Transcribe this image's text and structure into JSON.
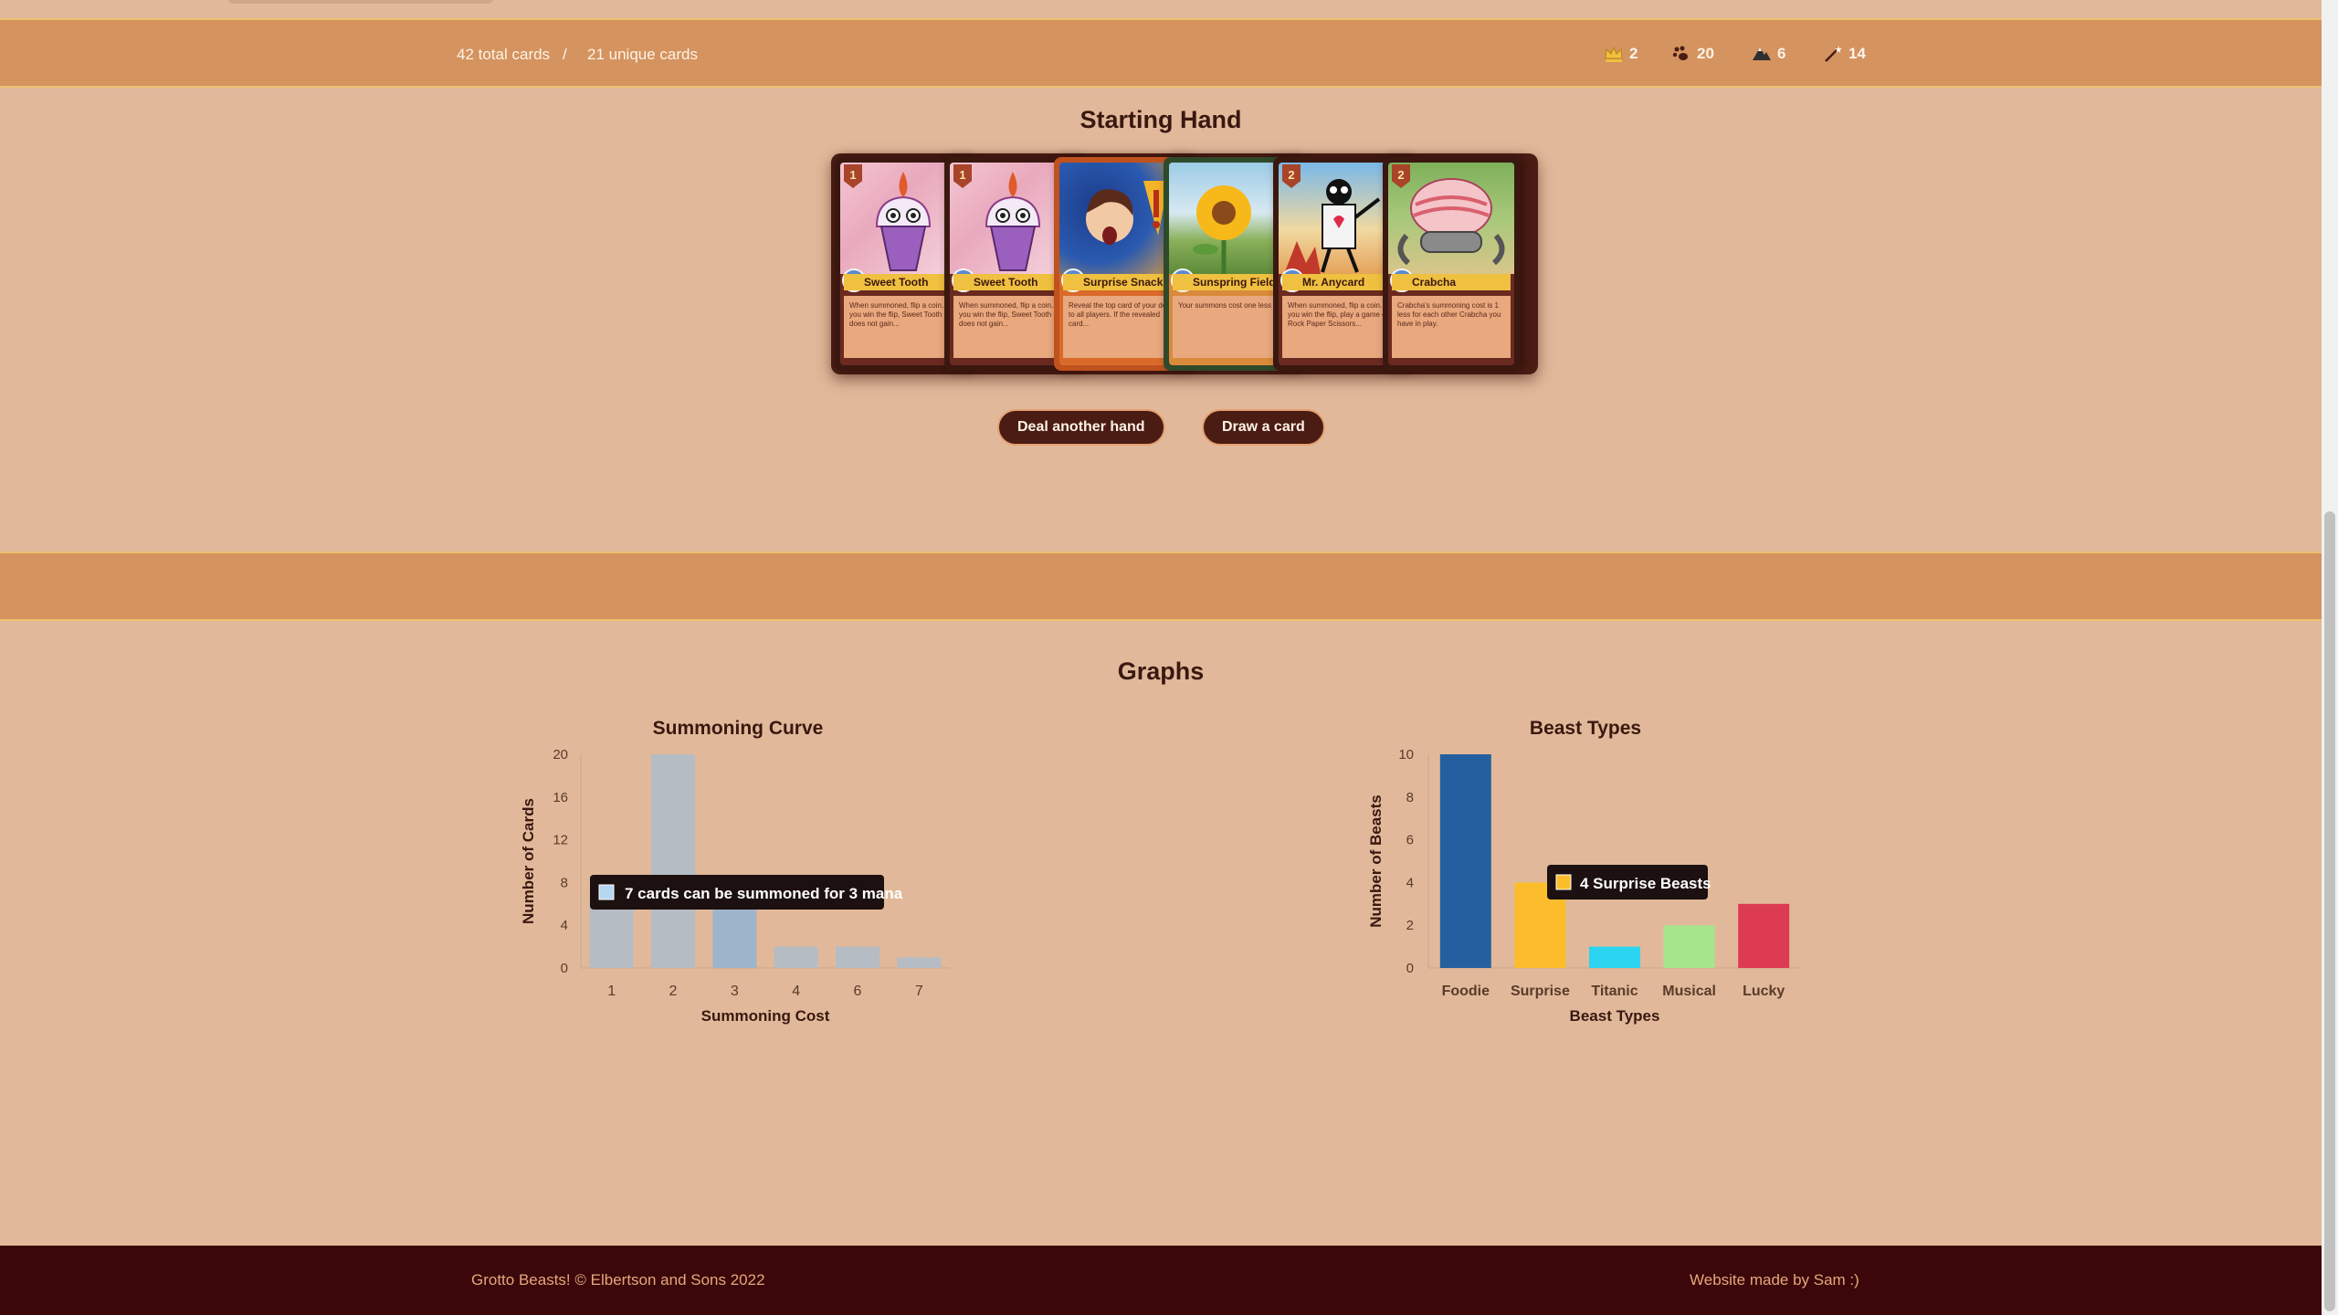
{
  "stats": {
    "total_cards": "42 total cards",
    "separator": "/",
    "unique_cards": "21 unique cards",
    "types": [
      {
        "icon": "crown-icon",
        "count": "2",
        "color": "#f0c040"
      },
      {
        "icon": "paw-icon",
        "count": "20",
        "color": "#3a1810"
      },
      {
        "icon": "mountain-icon",
        "count": "6",
        "color": "#3a1810"
      },
      {
        "icon": "wand-icon",
        "count": "14",
        "color": "#3a1810"
      }
    ]
  },
  "hand": {
    "title": "Starting Hand",
    "cards": [
      {
        "name": "Sweet Tooth",
        "cost": "1",
        "gem": "2",
        "art": "sweet",
        "text": "When summoned, flip a coin... If you win the flip, Sweet Tooth does not gain..."
      },
      {
        "name": "Sweet Tooth",
        "cost": "1",
        "gem": "2",
        "art": "sweet",
        "text": "When summoned, flip a coin... If you win the flip, Sweet Tooth does not gain..."
      },
      {
        "name": "Surprise Snack",
        "cost": "",
        "gem": "1",
        "art": "surprise",
        "text": "Reveal the top card of your deck to all players. If the revealed card..."
      },
      {
        "name": "Sunspring Field",
        "cost": "",
        "gem": "1",
        "art": "sunspring",
        "text": "Your summons cost one less to..."
      },
      {
        "name": "Mr. Anycard",
        "cost": "2",
        "gem": "2",
        "art": "anycard",
        "text": "When summoned, flip a coin. If you win the flip, play a game of Rock Paper Scissors..."
      },
      {
        "name": "Crabcha",
        "cost": "2",
        "gem": "2",
        "art": "crabcha",
        "text": "Crabcha's summoning cost is 1 less for each other Crabcha you have in play."
      }
    ],
    "deal_button": "Deal another hand",
    "draw_button": "Draw a card"
  },
  "graphs": {
    "title": "Graphs"
  },
  "chart_data": [
    {
      "type": "bar",
      "title": "Summoning Curve",
      "xlabel": "Summoning Cost",
      "ylabel": "Number of Cards",
      "categories": [
        "1",
        "2",
        "3",
        "4",
        "6",
        "7"
      ],
      "values": [
        7,
        20,
        7,
        2,
        2,
        1
      ],
      "ylim": [
        0,
        20
      ],
      "yticks": [
        "0",
        "4",
        "8",
        "12",
        "16",
        "20"
      ],
      "bar_color": "#b5bcc4",
      "highlight_color": "#9db4ca",
      "highlight_index": 2,
      "tooltip": "7 cards can be summoned for 3 mana",
      "tooltip_swatch": "#b5d6ee"
    },
    {
      "type": "bar",
      "title": "Beast Types",
      "xlabel": "Beast Types",
      "ylabel": "Number of Beasts",
      "categories": [
        "Foodie",
        "Surprise",
        "Titanic",
        "Musical",
        "Lucky"
      ],
      "values": [
        10,
        4,
        1,
        2,
        3
      ],
      "ylim": [
        0,
        10
      ],
      "yticks": [
        "0",
        "2",
        "4",
        "6",
        "8",
        "10"
      ],
      "colors": [
        "#2460a0",
        "#fbbd2b",
        "#2bd4f0",
        "#a7e58c",
        "#dd3b52"
      ],
      "tooltip": "4 Surprise Beasts",
      "tooltip_swatch": "#fbbd2b"
    }
  ],
  "footer": {
    "left": "Grotto Beasts! © Elbertson and Sons 2022",
    "right": "Website made by Sam :)"
  }
}
